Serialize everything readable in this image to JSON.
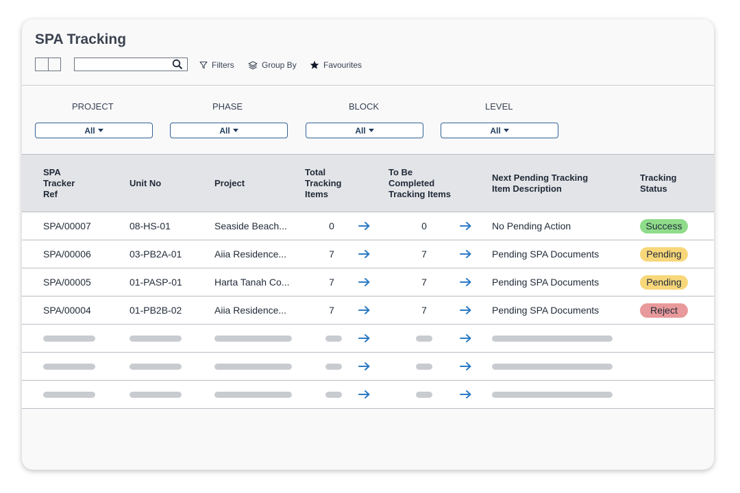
{
  "page": {
    "title": "SPA Tracking"
  },
  "toolbar": {
    "search_placeholder": "",
    "filters_label": "Filters",
    "group_by_label": "Group By",
    "favourites_label": "Favourites"
  },
  "filters": [
    {
      "label": "PROJECT",
      "value": "All"
    },
    {
      "label": "PHASE",
      "value": "All"
    },
    {
      "label": "BLOCK",
      "value": "All"
    },
    {
      "label": "LEVEL",
      "value": "All"
    }
  ],
  "table": {
    "headers": {
      "ref": [
        "SPA",
        "Tracker",
        "Ref"
      ],
      "unit": "Unit No",
      "project": "Project",
      "total": [
        "Total",
        "Tracking",
        "Items"
      ],
      "to_be": [
        "To Be",
        "Completed",
        "Tracking Items"
      ],
      "next": [
        "Next Pending Tracking",
        "Item Description"
      ],
      "status": [
        "Tracking",
        "Status"
      ]
    },
    "rows": [
      {
        "ref": "SPA/00007",
        "unit": "08-HS-01",
        "project": "Seaside Beach...",
        "total": "0",
        "to_be": "0",
        "next": "No Pending Action",
        "status": "Success",
        "status_color": "#8fdc8a"
      },
      {
        "ref": "SPA/00006",
        "unit": "03-PB2A-01",
        "project": "Aiia Residence...",
        "total": "7",
        "to_be": "7",
        "next": "Pending SPA Documents",
        "status": "Pending",
        "status_color": "#f8d77a"
      },
      {
        "ref": "SPA/00005",
        "unit": "01-PASP-01",
        "project": "Harta Tanah Co...",
        "total": "7",
        "to_be": "7",
        "next": "Pending SPA Documents",
        "status": "Pending",
        "status_color": "#f8d77a"
      },
      {
        "ref": "SPA/00004",
        "unit": "01-PB2B-02",
        "project": "Aiia Residence...",
        "total": "7",
        "to_be": "7",
        "next": "Pending SPA Documents",
        "status": "Reject",
        "status_color": "#e8999b"
      }
    ],
    "skeleton_rows": 3
  },
  "colors": {
    "accent": "#2a79c4",
    "success": "#8fdc8a",
    "pending": "#f8d77a",
    "reject": "#e8999b"
  }
}
